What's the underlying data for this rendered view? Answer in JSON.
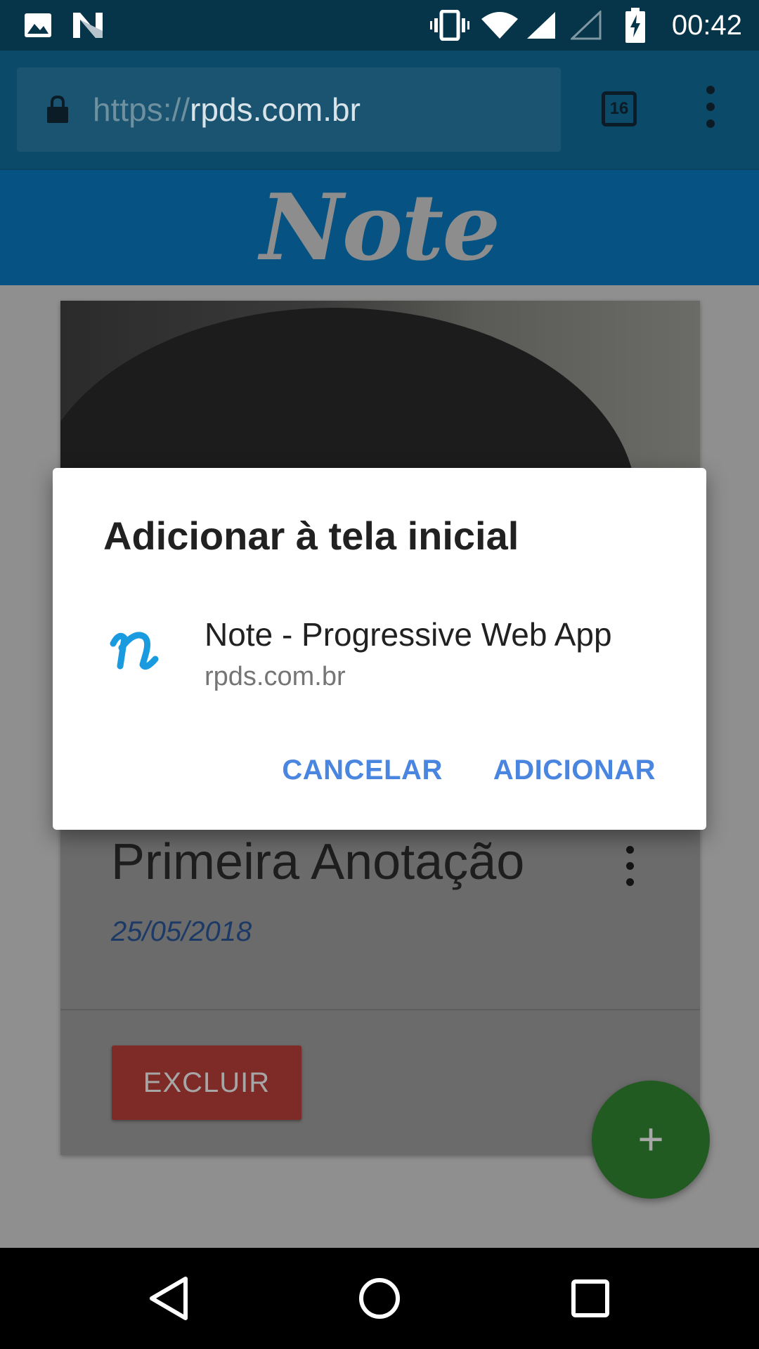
{
  "status_bar": {
    "time": "00:42",
    "left_icons": [
      "image-icon",
      "n-notification-icon"
    ],
    "right_icons": [
      "vibrate-icon",
      "wifi-icon",
      "signal-icon",
      "no-signal-icon",
      "battery-charging-icon"
    ]
  },
  "browser": {
    "url_scheme": "https://",
    "url_host": "rpds.com.br",
    "tab_count": "16",
    "menu_icon": "more-vert-icon"
  },
  "app": {
    "logo_text": "Note"
  },
  "card": {
    "title": "Primeira Anotação",
    "date": "25/05/2018",
    "delete_label": "EXCLUIR"
  },
  "fab": {
    "label": "+"
  },
  "dialog": {
    "title": "Adicionar à tela inicial",
    "icon_letter": "n",
    "app_name": "Note - Progressive Web App",
    "app_origin": "rpds.com.br",
    "cancel_label": "CANCELAR",
    "add_label": "ADICIONAR"
  },
  "colors": {
    "toolbar": "#0b4b69",
    "dialog_button": "#4a86e0",
    "app_icon": "#1a9be0"
  }
}
